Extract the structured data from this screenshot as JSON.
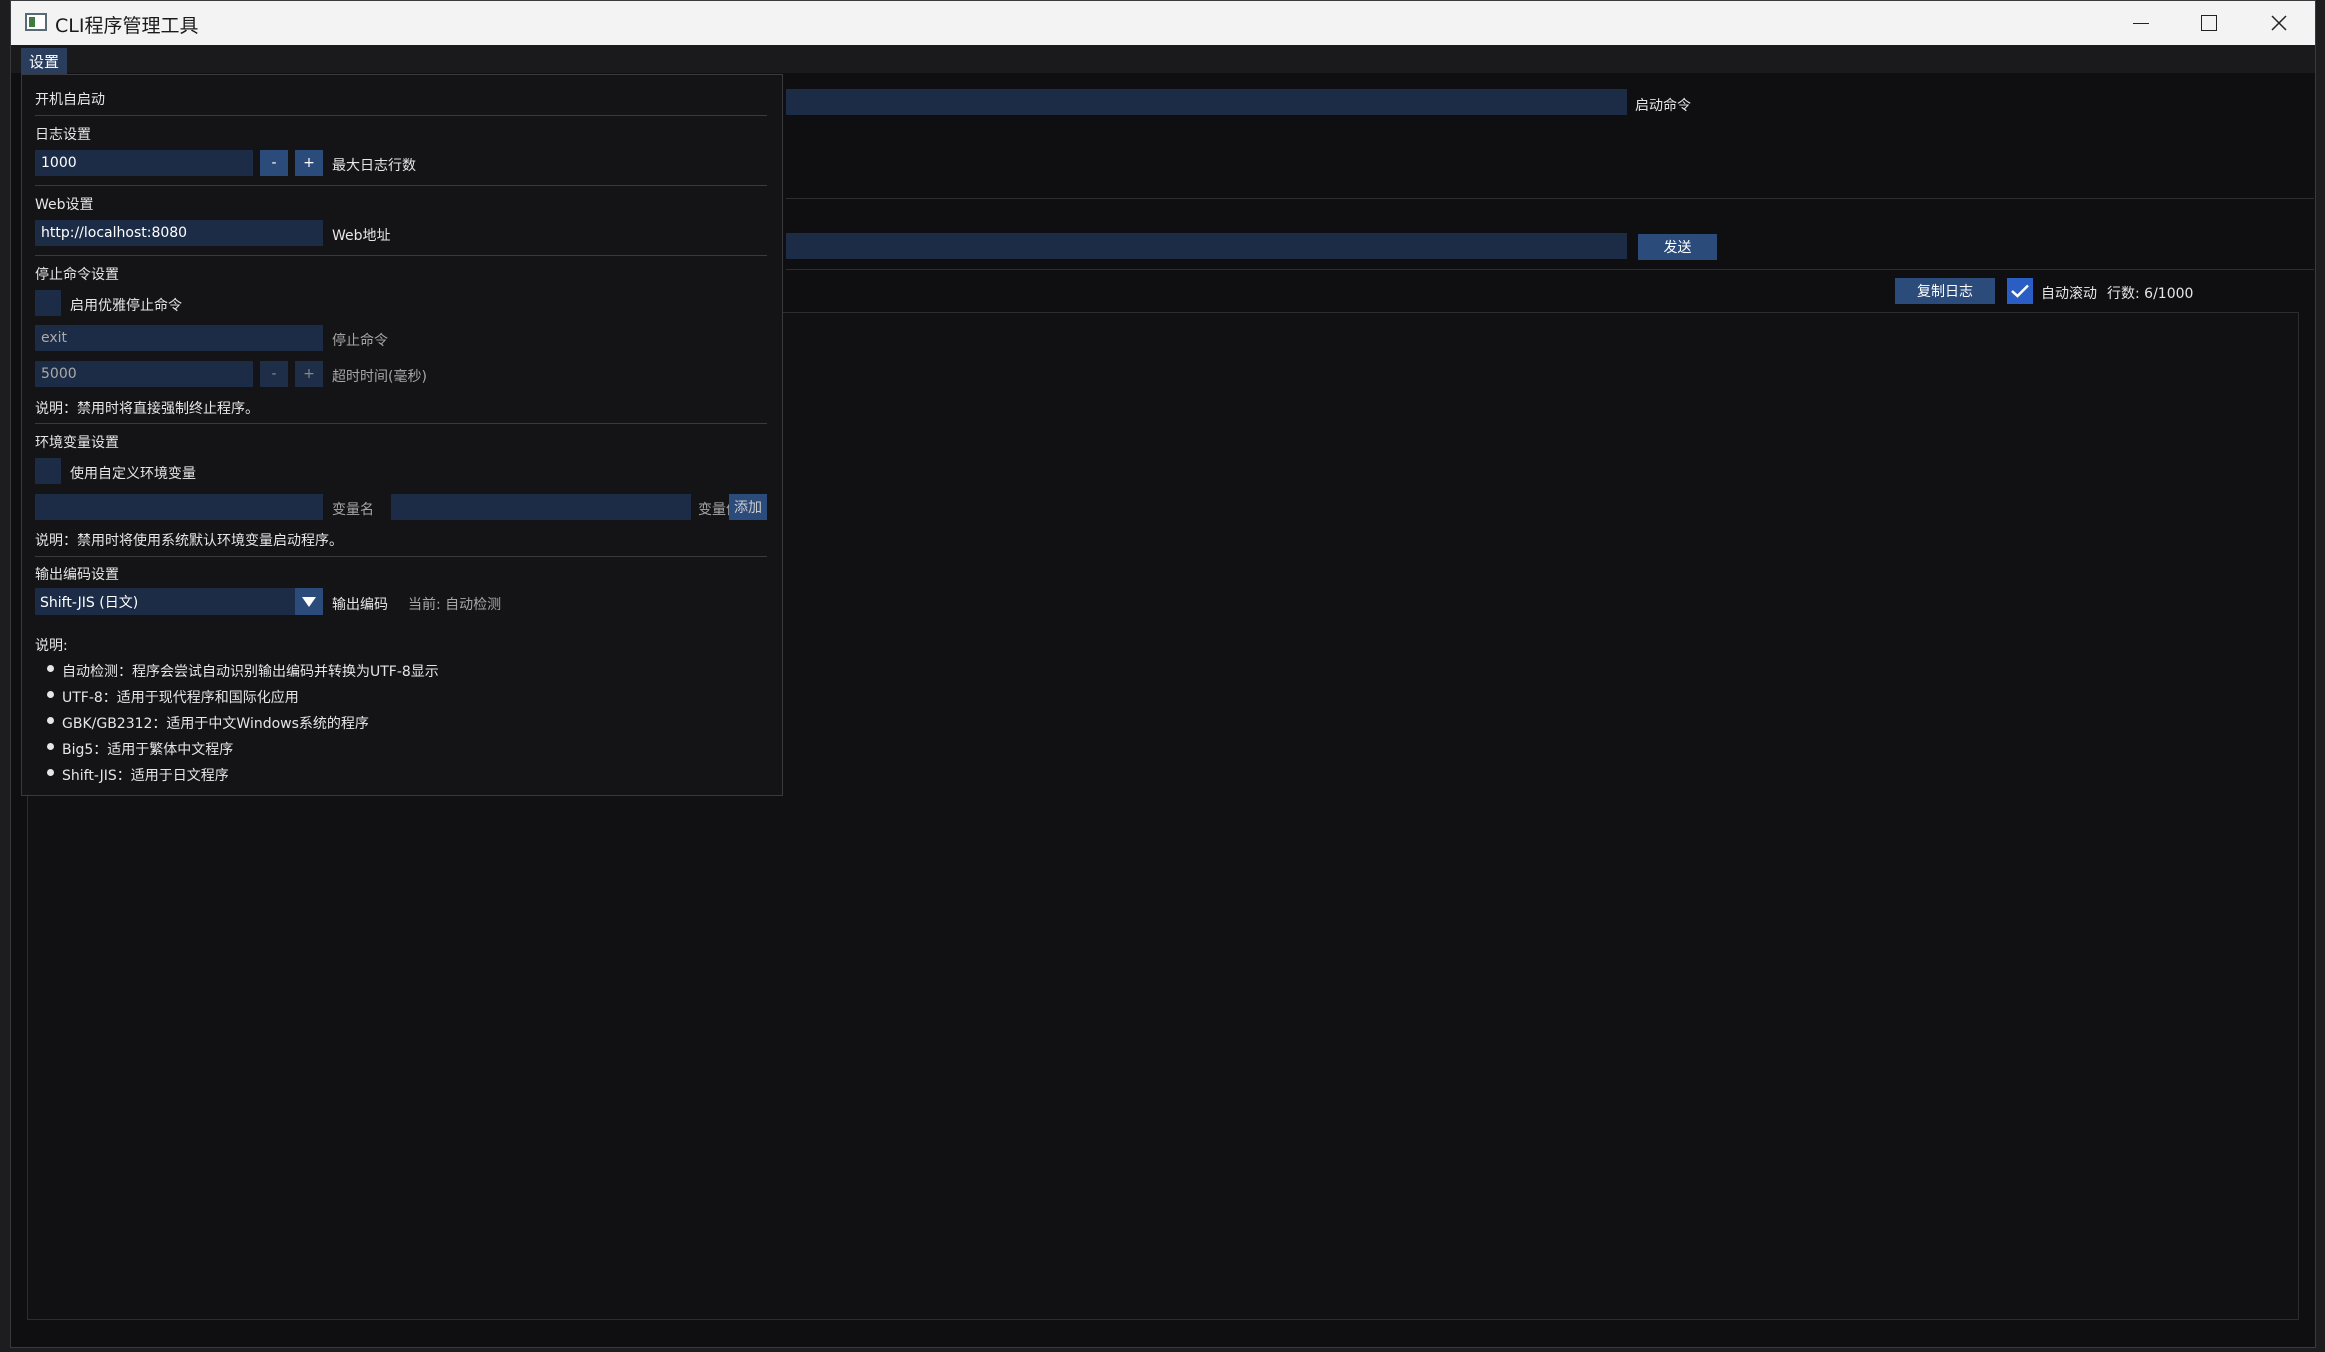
{
  "window": {
    "title": "CLI程序管理工具"
  },
  "menu": {
    "settings": "设置"
  },
  "main": {
    "start_command_label": "启动命令",
    "send_button": "发送",
    "copy_log_button": "复制日志",
    "auto_scroll_label": "自动滚动",
    "auto_scroll_checked": true,
    "line_count": "行数: 6/1000"
  },
  "settings": {
    "autostart": "开机自启动",
    "log": {
      "heading": "日志设置",
      "max_lines_value": "1000",
      "decrement": "-",
      "increment": "+",
      "max_lines_label": "最大日志行数"
    },
    "web": {
      "heading": "Web设置",
      "address_value": "http://localhost:8080",
      "address_label": "Web地址"
    },
    "stop": {
      "heading": "停止命令设置",
      "enable_label": "启用优雅停止命令",
      "command_value": "exit",
      "command_label": "停止命令",
      "timeout_value": "5000",
      "decrement": "-",
      "increment": "+",
      "timeout_label": "超时时间(毫秒)",
      "note": "说明：禁用时将直接强制终止程序。"
    },
    "env": {
      "heading": "环境变量设置",
      "enable_label": "使用自定义环境变量",
      "name_label": "变量名",
      "value_label": "变量值",
      "add_button": "添加",
      "note": "说明：禁用时将使用系统默认环境变量启动程序。"
    },
    "encoding": {
      "heading": "输出编码设置",
      "selected": "Shift-JIS (日文)",
      "label": "输出编码",
      "current": "当前: 自动检测",
      "note_heading": "说明:",
      "notes": [
        "自动检测：程序会尝试自动识别输出编码并转换为UTF-8显示",
        "UTF-8：适用于现代程序和国际化应用",
        "GBK/GB2312：适用于中文Windows系统的程序",
        "Big5：适用于繁体中文程序",
        "Shift-JIS：适用于日文程序"
      ]
    }
  },
  "colors": {
    "accent": "#2b4b7a",
    "input_bg": "#1d2c46",
    "checkbox_checked": "#2a5ec4",
    "background": "#0f0f11"
  }
}
